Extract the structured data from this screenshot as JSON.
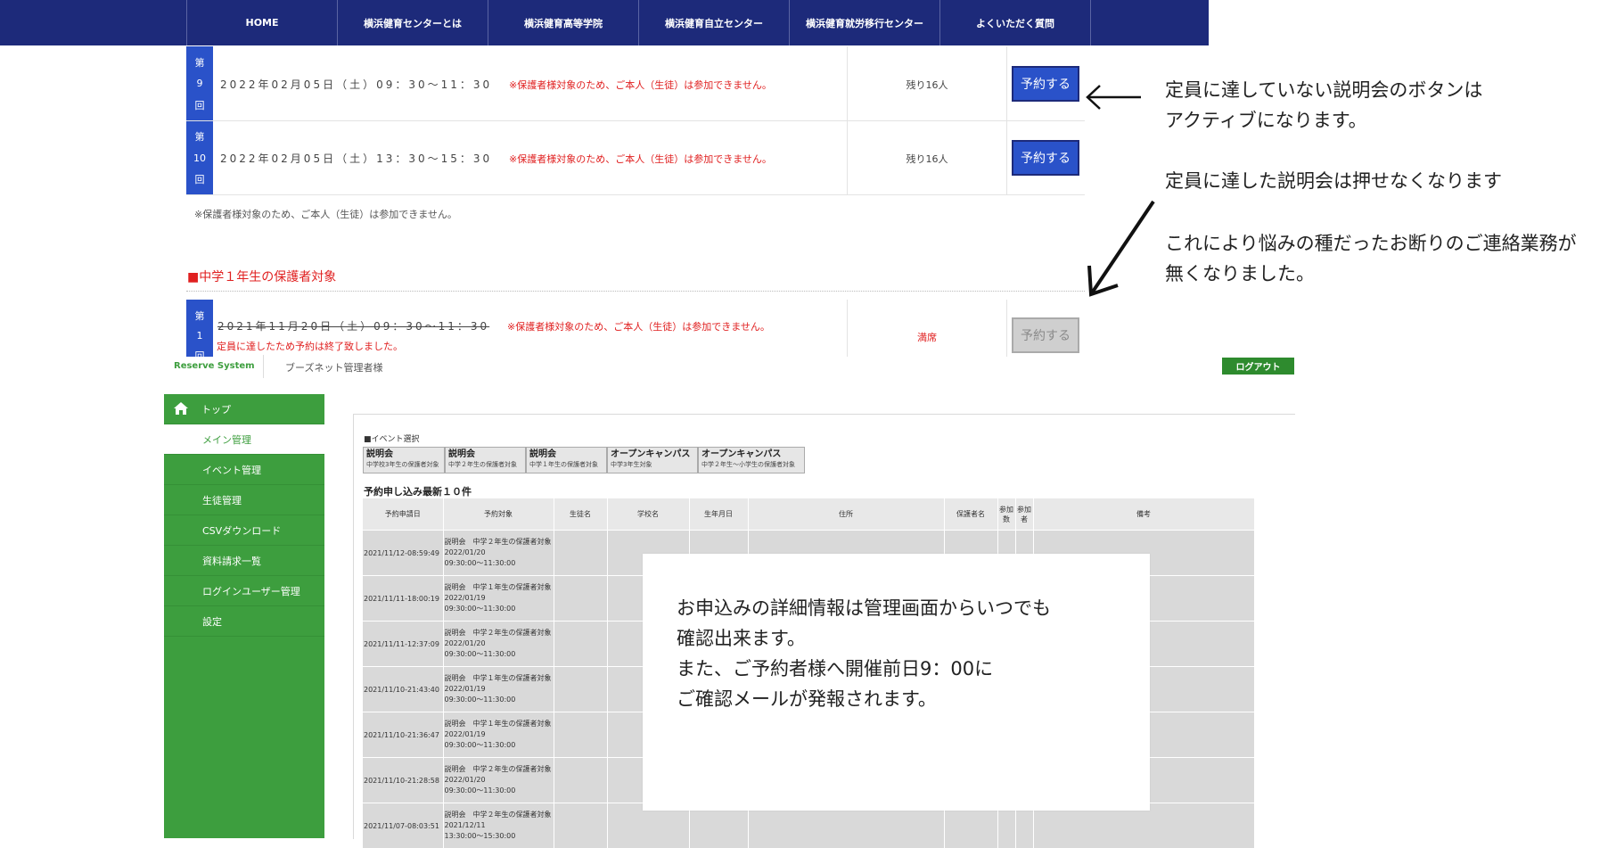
{
  "nav": {
    "items": [
      "HOME",
      "横浜健育センターとは",
      "横浜健育高等学院",
      "横浜健育自立センター",
      "横浜健育就労移行センター",
      "よくいただく質問"
    ]
  },
  "sessions": [
    {
      "badge_top": "第",
      "badge_num": "9",
      "badge_bottom": "回",
      "date": "2022年02月05日（土）09：30〜11：30",
      "note": "※保護者様対象のため、ご本人（生徒）は参加できません。",
      "remaining": "残り16人",
      "button": "予約する"
    },
    {
      "badge_top": "第",
      "badge_num": "10",
      "badge_bottom": "回",
      "date": "2022年02月05日（土）13：30〜15：30",
      "note": "※保護者様対象のため、ご本人（生徒）は参加できません。",
      "remaining": "残り16人",
      "button": "予約する"
    }
  ],
  "footnote": "※保護者様対象のため、ご本人（生徒）は参加できません。",
  "section_title": "■中学１年生の保護者対象",
  "full_session": {
    "badge_top": "第",
    "badge_num": "1",
    "badge_bottom": "回",
    "date": "2021年11月20日（土）09：30〜11：30",
    "closed_note": "定員に達したため予約は終了致しました。",
    "note": "※保護者様対象のため、ご本人（生徒）は参加できません。",
    "status": "満席",
    "button": "予約する"
  },
  "annotations": {
    "a1_line1": "定員に達していない説明会のボタンは",
    "a1_line2": "アクティブになります。",
    "a2": "定員に達した説明会は押せなくなります",
    "a3_line1": "これにより悩みの種だったお断りのご連絡業務が",
    "a3_line2": "無くなりました。",
    "a4_line1": "お申込みの詳細情報は管理画面からいつでも",
    "a4_line2": "確認出来ます。",
    "a4_line3": "また、ご予約者様へ開催前日9：00に",
    "a4_line4": "ご確認メールが発報されます。"
  },
  "admin": {
    "brand": "Reserve System",
    "user": "ブーズネット管理者様",
    "logout": "ログアウト",
    "sidebar": [
      {
        "label": "トップ",
        "icon": "home-icon"
      },
      {
        "label": "メイン管理"
      },
      {
        "label": "イベント管理"
      },
      {
        "label": "生徒管理"
      },
      {
        "label": "CSVダウンロード"
      },
      {
        "label": "資料請求一覧"
      },
      {
        "label": "ログインユーザー管理"
      },
      {
        "label": "設定"
      }
    ],
    "event_select_label": "■イベント選択",
    "events": [
      {
        "title": "説明会",
        "sub": "中学校3年生の保護者対象"
      },
      {
        "title": "説明会",
        "sub": "中学２年生の保護者対象"
      },
      {
        "title": "説明会",
        "sub": "中学１年生の保護者対象"
      },
      {
        "title": "オープンキャンパス",
        "sub": "中学3年生対象"
      },
      {
        "title": "オープンキャンパス",
        "sub": "中学２年生〜小学生の保護者対象"
      }
    ],
    "recent_title": "予約申し込み最新１０件",
    "columns": [
      "予約申請日",
      "予約対象",
      "生徒名",
      "学校名",
      "生年月日",
      "住所",
      "保護者名",
      "参加数",
      "参加者",
      "備考"
    ],
    "rows": [
      {
        "date": "2021/11/12-08:59:49",
        "t1": "説明会　中学２年生の保護者対象",
        "t2": "2022/01/20",
        "t3": "09:30:00〜11:30:00"
      },
      {
        "date": "2021/11/11-18:00:19",
        "t1": "説明会　中学１年生の保護者対象",
        "t2": "2022/01/19",
        "t3": "09:30:00〜11:30:00"
      },
      {
        "date": "2021/11/11-12:37:09",
        "t1": "説明会　中学２年生の保護者対象",
        "t2": "2022/01/20",
        "t3": "09:30:00〜11:30:00"
      },
      {
        "date": "2021/11/10-21:43:40",
        "t1": "説明会　中学１年生の保護者対象",
        "t2": "2022/01/19",
        "t3": "09:30:00〜11:30:00"
      },
      {
        "date": "2021/11/10-21:36:47",
        "t1": "説明会　中学１年生の保護者対象",
        "t2": "2022/01/19",
        "t3": "09:30:00〜11:30:00"
      },
      {
        "date": "2021/11/10-21:28:58",
        "t1": "説明会　中学２年生の保護者対象",
        "t2": "2022/01/20",
        "t3": "09:30:00〜11:30:00"
      },
      {
        "date": "2021/11/07-08:03:51",
        "t1": "説明会　中学２年生の保護者対象",
        "t2": "2021/12/11",
        "t3": "13:30:00〜15:30:00"
      }
    ]
  }
}
